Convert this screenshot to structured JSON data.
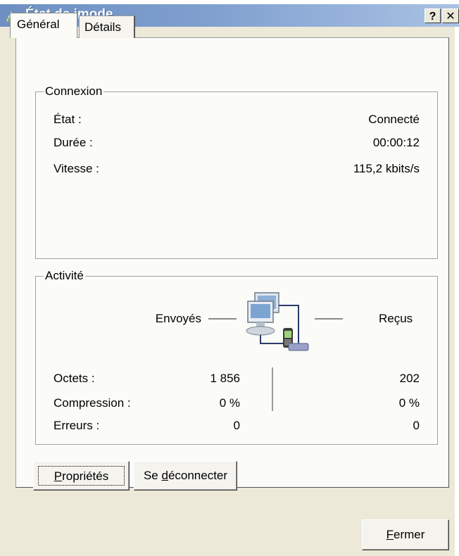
{
  "window": {
    "title": "État de imode",
    "help_glyph": "?",
    "close_glyph": "✕"
  },
  "tabs": [
    {
      "label": "Général",
      "active": true
    },
    {
      "label": "Détails",
      "active": false
    }
  ],
  "connexion": {
    "title": "Connexion",
    "rows": [
      {
        "label": "État :",
        "value": "Connecté"
      },
      {
        "label": "Durée :",
        "value": "00:00:12"
      },
      {
        "label": "Vitesse :",
        "value": "115,2 kbits/s"
      }
    ]
  },
  "activite": {
    "title": "Activité",
    "sent_label": "Envoyés",
    "received_label": "Reçus",
    "rows": [
      {
        "label": "Octets :",
        "sent": "1 856",
        "received": "202"
      },
      {
        "label": "Compression :",
        "sent": "0 %",
        "received": "0 %"
      },
      {
        "label": "Erreurs :",
        "sent": "0",
        "received": "0"
      }
    ]
  },
  "buttons": {
    "properties": {
      "pre": "",
      "mnemonic": "P",
      "post": "ropriétés"
    },
    "disconnect": {
      "pre": "Se ",
      "mnemonic": "d",
      "post": "éconnecter"
    },
    "close": {
      "pre": "",
      "mnemonic": "F",
      "post": "ermer"
    }
  },
  "colors": {
    "titlebar_start": "#6d8fc2",
    "titlebar_end": "#a9c1e3",
    "window_bg": "#ece9d8",
    "panel_bg": "#fbfbf7"
  },
  "icons": {
    "app": "network-connection-icon",
    "activity": "network-activity-icon"
  }
}
